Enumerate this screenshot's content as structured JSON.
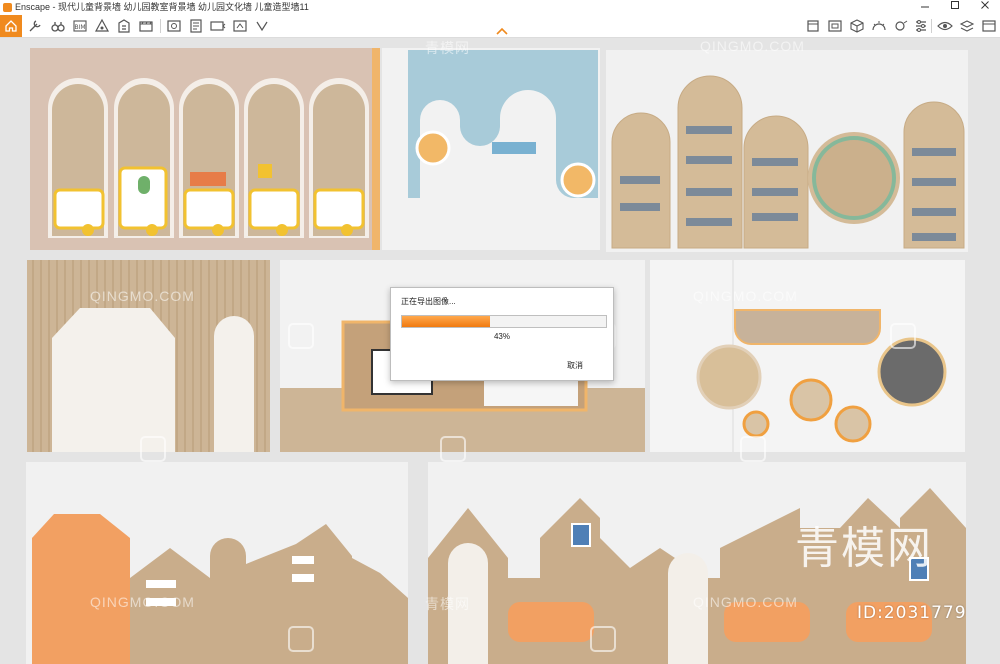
{
  "window": {
    "title": "Enscape - 现代儿童背景墙 幼儿园教室背景墙 幼儿园文化墙 儿童造型墙11",
    "controls": [
      "minimize",
      "maximize",
      "close"
    ]
  },
  "toolbar": {
    "left_icons": [
      "home-icon",
      "tool-icon",
      "binoculars-icon",
      "bim-icon",
      "asset-icon",
      "light-icon",
      "building-icon",
      "video-icon",
      "screenshot-icon",
      "batch-icon",
      "panorama-icon",
      "export-icon",
      "web-icon"
    ],
    "right_icons": [
      "cube-icon",
      "frame-icon",
      "box-icon",
      "sun-icon",
      "atmosphere-icon",
      "settings-icon",
      "eye-icon",
      "layers-icon",
      "window-icon"
    ],
    "collapse_icon": "chevron-up-icon",
    "accent": "#f08a1e"
  },
  "export_dialog": {
    "title": "正在导出图像...",
    "progress": 0.43,
    "progress_text": "43%",
    "cancel_label": "取消"
  },
  "watermarks": {
    "brand_latin": "QINGMO.COM",
    "brand_cn": "青模网",
    "big_cn": "青模网",
    "id": "ID:2031779"
  },
  "scene": {
    "panel_colors": {
      "beige": "#c9b299",
      "pink": "#d8c0b0",
      "blue": "#a9cbd8",
      "white": "#f3f3f3",
      "orange": "#f0a262",
      "wood": "#c8ad8c"
    }
  }
}
